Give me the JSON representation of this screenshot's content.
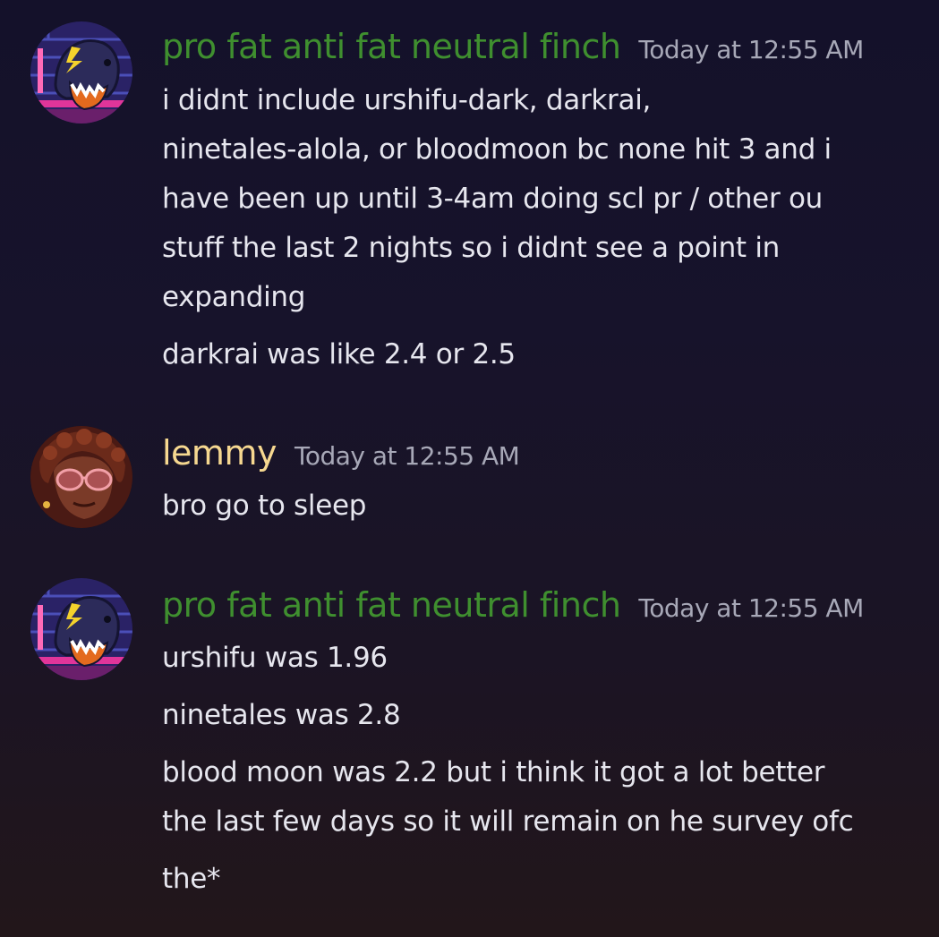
{
  "colors": {
    "finch_name": "#3f8f2f",
    "lemmy_name": "#f6d890",
    "timestamp": "#a7a8b7",
    "message_text": "#e6e6ee"
  },
  "messages": [
    {
      "author": "pro fat anti fat neutral finch",
      "timestamp": "Today at 12:55 AM",
      "avatar_icon": "cartoon-shark-avatar-icon",
      "lines": [
        "i didnt include urshifu-dark, darkrai,",
        "ninetales-alola, or bloodmoon bc none hit 3 and i",
        "have been up until 3-4am doing scl pr / other ou",
        "stuff the last 2 nights so i didnt see a point in",
        "expanding",
        "darkrai was like 2.4 or 2.5"
      ]
    },
    {
      "author": "lemmy",
      "timestamp": "Today at 12:55 AM",
      "avatar_icon": "person-with-glasses-avatar-icon",
      "lines": [
        "bro go to sleep"
      ]
    },
    {
      "author": "pro fat anti fat neutral finch",
      "timestamp": "Today at 12:55 AM",
      "avatar_icon": "cartoon-shark-avatar-icon",
      "lines": [
        "urshifu was 1.96",
        "ninetales was 2.8",
        "blood moon was 2.2 but i think it got a lot better",
        "the last few days so it will remain on he survey ofc",
        "the*"
      ]
    }
  ]
}
